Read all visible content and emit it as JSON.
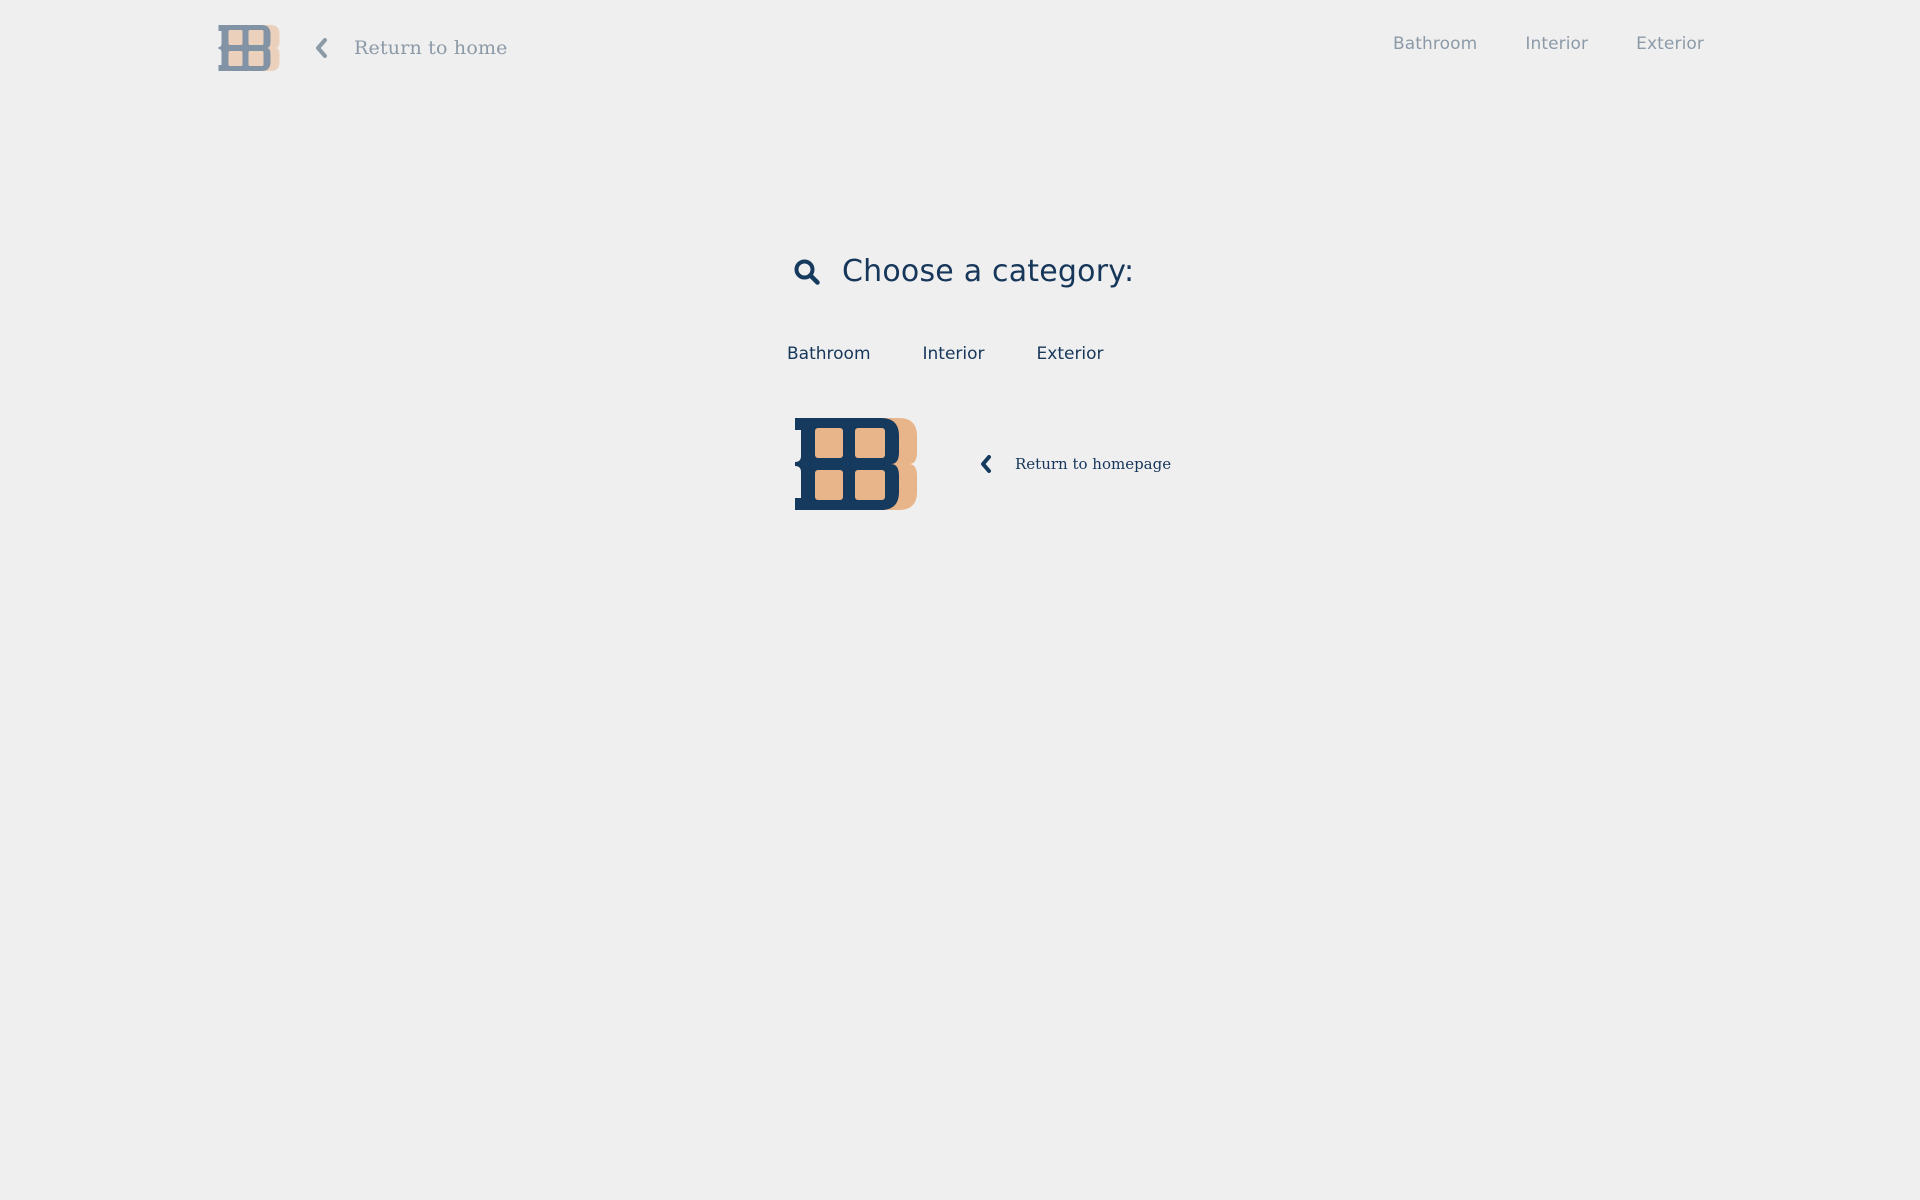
{
  "colors": {
    "background": "#efefef",
    "primary_navy": "#163a5e",
    "accent_peach": "#e8b48a",
    "muted_text": "#8c9aa8",
    "heading_text": "#16365a"
  },
  "header": {
    "logo_icon": "bb-logo-icon",
    "back_icon": "chevron-left-icon",
    "back_label": "Return to home",
    "nav": [
      {
        "label": "Bathroom"
      },
      {
        "label": "Interior"
      },
      {
        "label": "Exterior"
      }
    ]
  },
  "main": {
    "title_icon": "search-icon",
    "title": "Choose a category:",
    "categories": [
      {
        "label": "Bathroom"
      },
      {
        "label": "Interior"
      },
      {
        "label": "Exterior"
      }
    ],
    "logo_icon": "bb-logo-icon",
    "home_icon": "chevron-left-icon",
    "home_label": "Return to homepage"
  }
}
